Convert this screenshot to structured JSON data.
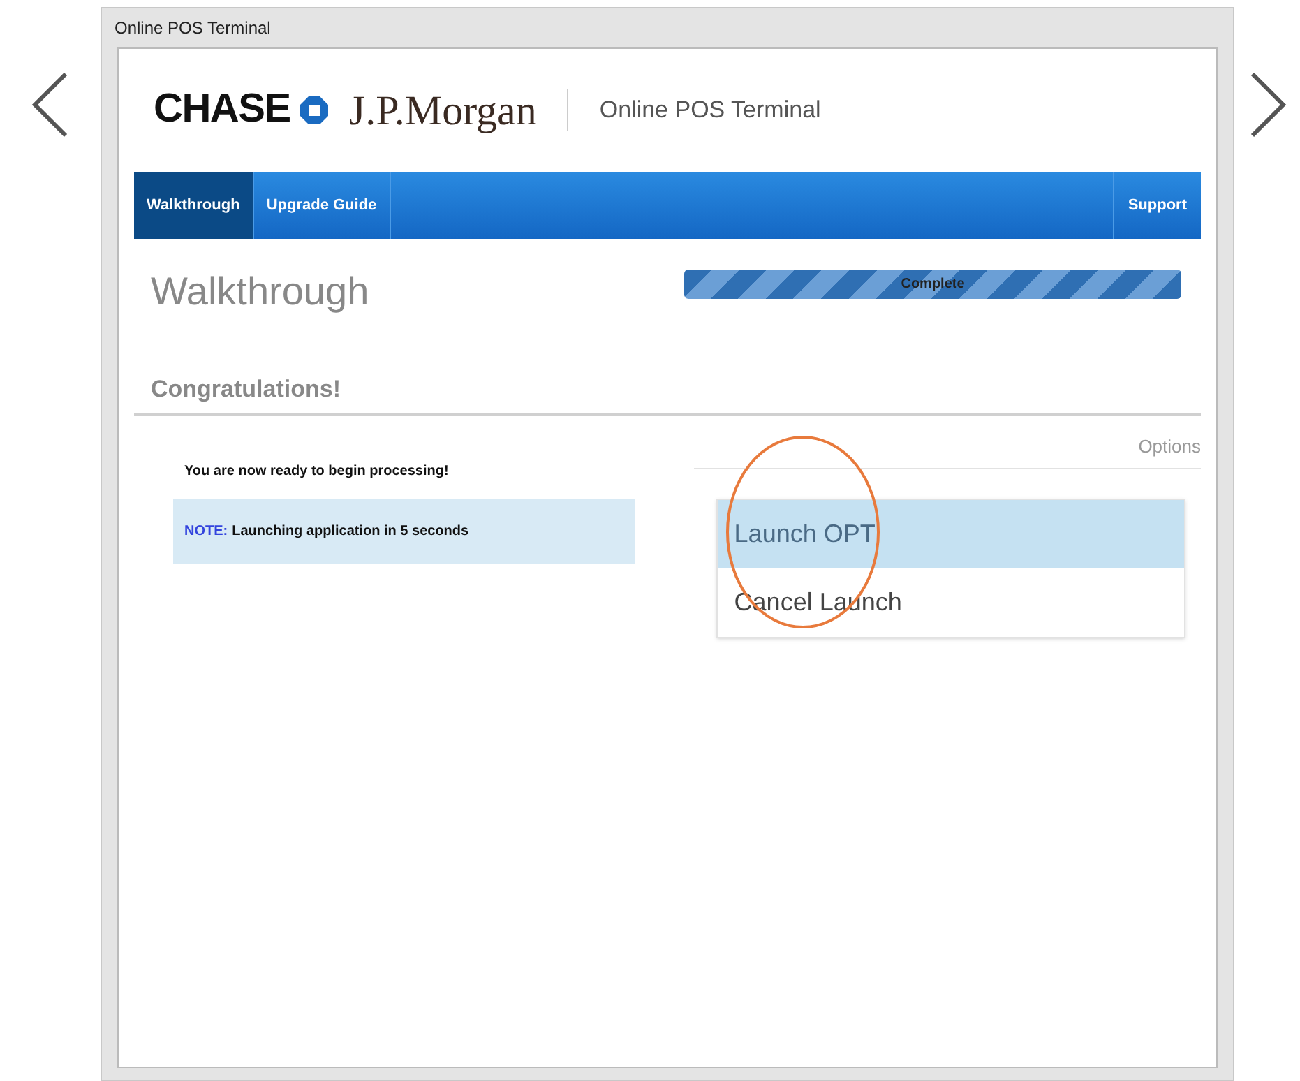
{
  "window": {
    "title": "Online POS Terminal"
  },
  "header": {
    "brand": "CHASE",
    "brand_secondary": "J.P.Morgan",
    "product": "Online POS Terminal"
  },
  "nav": {
    "tabs": [
      {
        "label": "Walkthrough",
        "selected": true
      },
      {
        "label": "Upgrade Guide",
        "selected": false
      }
    ],
    "right_link": "Support"
  },
  "page_title": "Walkthrough",
  "progress": {
    "label": "Complete",
    "level": 1
  },
  "section_title": "Congratulations!",
  "message": "You are now ready to begin processing!",
  "note": {
    "label": "NOTE:",
    "text": "Launching application in 5 seconds"
  },
  "options": {
    "heading": "Options",
    "items": [
      {
        "label": "Launch OPT",
        "selected": true
      },
      {
        "label": "Cancel Launch",
        "selected": false
      }
    ],
    "highlighted": true
  }
}
